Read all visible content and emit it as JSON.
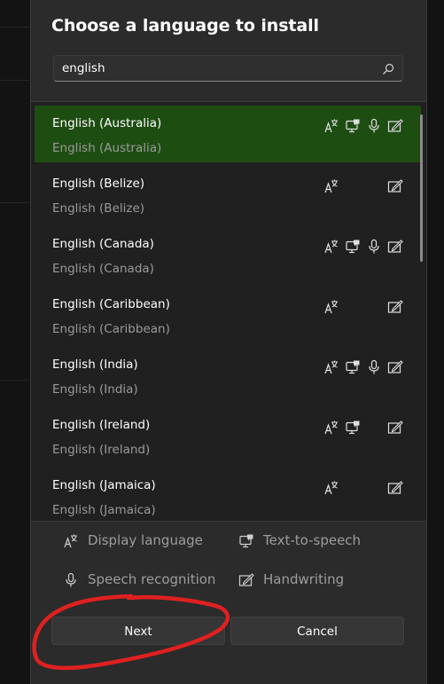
{
  "dialog": {
    "title": "Choose a language to install",
    "search": {
      "value": "english",
      "icon": "search-icon"
    }
  },
  "languages": [
    {
      "name": "English (Australia)",
      "native": "English (Australia)",
      "selected": true,
      "features": [
        "display-language",
        "text-to-speech",
        "speech-recognition",
        "handwriting"
      ]
    },
    {
      "name": "English (Belize)",
      "native": "English (Belize)",
      "selected": false,
      "features": [
        "display-language",
        "handwriting"
      ]
    },
    {
      "name": "English (Canada)",
      "native": "English (Canada)",
      "selected": false,
      "features": [
        "display-language",
        "text-to-speech",
        "speech-recognition",
        "handwriting"
      ]
    },
    {
      "name": "English (Caribbean)",
      "native": "English (Caribbean)",
      "selected": false,
      "features": [
        "display-language",
        "handwriting"
      ]
    },
    {
      "name": "English (India)",
      "native": "English (India)",
      "selected": false,
      "features": [
        "display-language",
        "text-to-speech",
        "speech-recognition",
        "handwriting"
      ]
    },
    {
      "name": "English (Ireland)",
      "native": "English (Ireland)",
      "selected": false,
      "features": [
        "display-language",
        "text-to-speech",
        "handwriting"
      ]
    },
    {
      "name": "English (Jamaica)",
      "native": "English (Jamaica)",
      "selected": false,
      "features": [
        "display-language",
        "handwriting"
      ]
    }
  ],
  "legend": {
    "display_language": "Display language",
    "text_to_speech": "Text-to-speech",
    "speech_recognition": "Speech recognition",
    "handwriting": "Handwriting"
  },
  "buttons": {
    "next": "Next",
    "cancel": "Cancel"
  },
  "colors": {
    "selected_row": "#1e4d12",
    "annotation": "#e02020",
    "dialog_bg": "#2b2b2b",
    "list_bg": "#202020"
  }
}
